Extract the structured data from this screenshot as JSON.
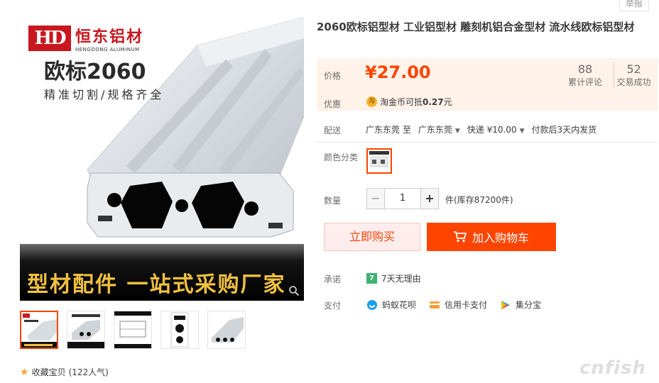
{
  "header": {
    "report_label": "举报"
  },
  "gallery": {
    "logo_mark": "HD",
    "logo_cn": "恒东铝材",
    "logo_en": "HENGDONG ALUMINUM",
    "hero_title": "欧标2060",
    "hero_subtitle": "精准切割/规格齐全",
    "banner_text": "型材配件 一站式采购厂家",
    "thumbnail_count": 5,
    "favorite_label": "收藏宝贝",
    "favorite_count": "(122人气)"
  },
  "product": {
    "title": "2060欧标铝型材 工业铝型材 雕刻机铝合金型材 流水线欧标铝型材",
    "price_label": "价格",
    "price": "¥27.00",
    "reviews_count": "88",
    "reviews_label": "累计评论",
    "sales_count": "52",
    "sales_label": "交易成功",
    "promo_label": "优惠",
    "coin_icon_text": "淘",
    "promo_text_prefix": "淘金币可抵",
    "promo_amount": "0.27",
    "promo_unit": "元",
    "shipping_label": "配送",
    "ship_from": "广东东莞 至",
    "ship_to": "广东东莞",
    "ship_method": "快递 ¥10.00",
    "ship_time": "付款后3天内发货",
    "color_label": "颜色分类",
    "qty_label": "数量",
    "qty_value": "1",
    "qty_minus": "−",
    "qty_plus": "+",
    "stock_text": "件(库存87200件)",
    "buy_now_label": "立即购买",
    "add_cart_label": "加入购物车",
    "promise_label": "承诺",
    "promise_badge": "7",
    "promise_text": "7天无理由",
    "pay_label": "支付",
    "pay_methods": [
      {
        "name": "蚂蚁花呗",
        "color": "#1a9dea"
      },
      {
        "name": "信用卡支付",
        "color": "#f5a03a"
      },
      {
        "name": "集分宝",
        "color": "#2fa8e0"
      }
    ]
  },
  "colors": {
    "accent": "#ff4400",
    "price_bg": "#fff2e8",
    "banner_text": "#f2c141"
  },
  "watermark": "cnfish"
}
